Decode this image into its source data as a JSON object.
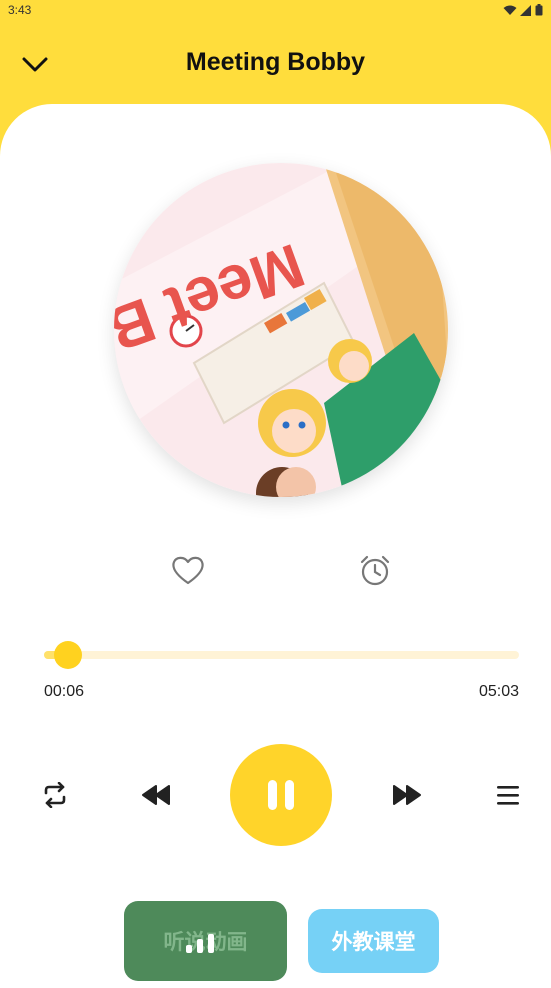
{
  "status_bar": {
    "time": "3:43"
  },
  "header": {
    "title": "Meeting Bobby"
  },
  "cover": {
    "text": "Meet Bobby"
  },
  "player": {
    "current_time": "00:06",
    "total_time": "05:03",
    "progress": 0.05
  },
  "bottom": {
    "left_button": "听说动画",
    "right_button": "外教课堂"
  },
  "colors": {
    "accent": "#FFDD3C",
    "play": "#FFD42A",
    "track": "#FFF3D6"
  }
}
